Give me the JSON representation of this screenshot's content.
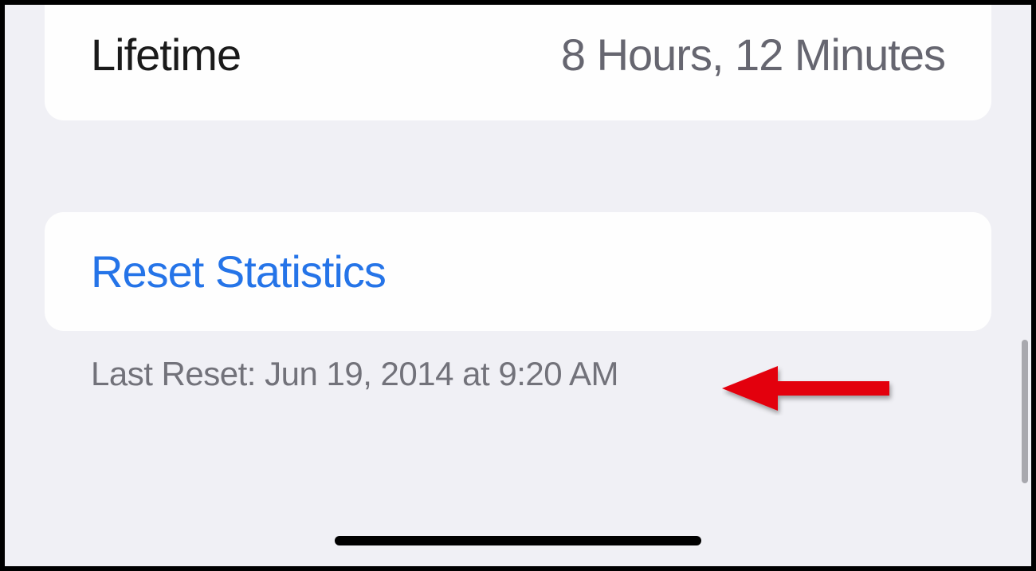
{
  "lifetime": {
    "label": "Lifetime",
    "value": "8 Hours, 12 Minutes"
  },
  "reset": {
    "button_label": "Reset Statistics",
    "last_reset_text": "Last Reset: Jun 19, 2014 at 9:20 AM"
  }
}
